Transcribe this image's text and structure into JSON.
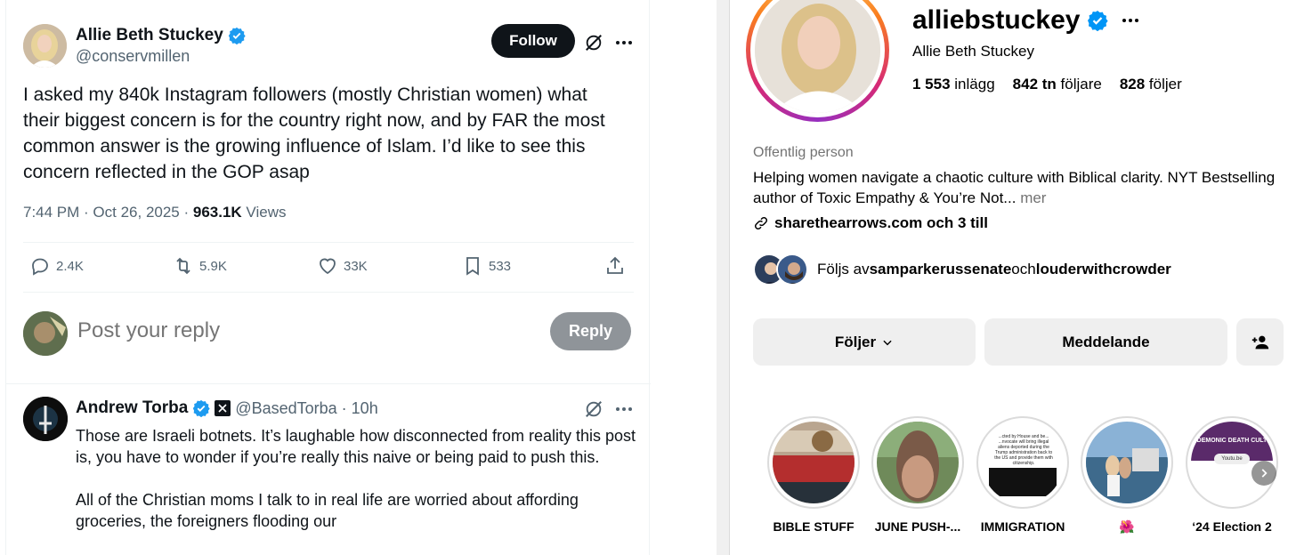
{
  "tweet": {
    "author_name": "Allie Beth Stuckey",
    "author_handle": "@conservmillen",
    "follow_label": "Follow",
    "text": "I asked my 840k Instagram followers (mostly Christian women) what their biggest concern is for the country right now, and by FAR the most common answer is the growing influence of Islam. I’d like to see this concern reflected in the GOP asap",
    "time": "7:44 PM · Oct 26, 2025 · ",
    "views_count": "963.1K",
    "views_label": " Views",
    "actions": {
      "replies": "2.4K",
      "retweets": "5.9K",
      "likes": "33K",
      "bookmarks": "533"
    },
    "reply_placeholder": "Post your reply",
    "reply_button": "Reply"
  },
  "reply": {
    "author_name": "Andrew Torba",
    "author_handle": "@BasedTorba",
    "time": " · 10h",
    "paragraph1": "Those are Israeli botnets. It’s laughable how disconnected from reality this post is, you have to wonder if you’re really this naive or being paid to push this.",
    "paragraph2": "All of the Christian moms I talk to in real life are worried about affording groceries, the foreigners flooding our"
  },
  "instagram": {
    "username": "alliebstuckey",
    "full_name": "Allie Beth Stuckey",
    "stats": {
      "posts_count": "1 553",
      "posts_label": " inlägg",
      "followers_count": "842 tn",
      "followers_label": " följare",
      "following_count": "828",
      "following_label": " följer"
    },
    "category": "Offentlig person",
    "bio": "Helping women navigate a chaotic culture with Biblical clarity. NYT Bestselling author of Toxic Empathy & You’re Not...",
    "bio_more": " mer",
    "link": "sharethearrows.com och 3 till",
    "mutuals_prefix": "Följs av ",
    "mutual1": "samparkerussenate",
    "mutuals_and": " och ",
    "mutual2": "louderwithcrowder",
    "buttons": {
      "following": "Följer",
      "message": "Meddelande"
    },
    "highlights": [
      {
        "label": "BIBLE STUFF"
      },
      {
        "label": "JUNE PUSH-..."
      },
      {
        "label": "IMMIGRATION"
      },
      {
        "label": "🌺"
      },
      {
        "label": "‘24 Election 2"
      }
    ],
    "highlight_texts": {
      "immigration": "...cted by House and be... ...nvocate will bring illegal aliens deported during the Trump administration back to the US and provide them with citizenship.",
      "election": "DEMONIC DEATH CULT",
      "youtube": "Youtu.be"
    }
  },
  "colors": {
    "x_text": "#0f1419",
    "x_secondary": "#536471",
    "verified_blue": "#1d9bf0",
    "ig_verified": "#0095f6",
    "ig_button_bg": "#efefef"
  }
}
